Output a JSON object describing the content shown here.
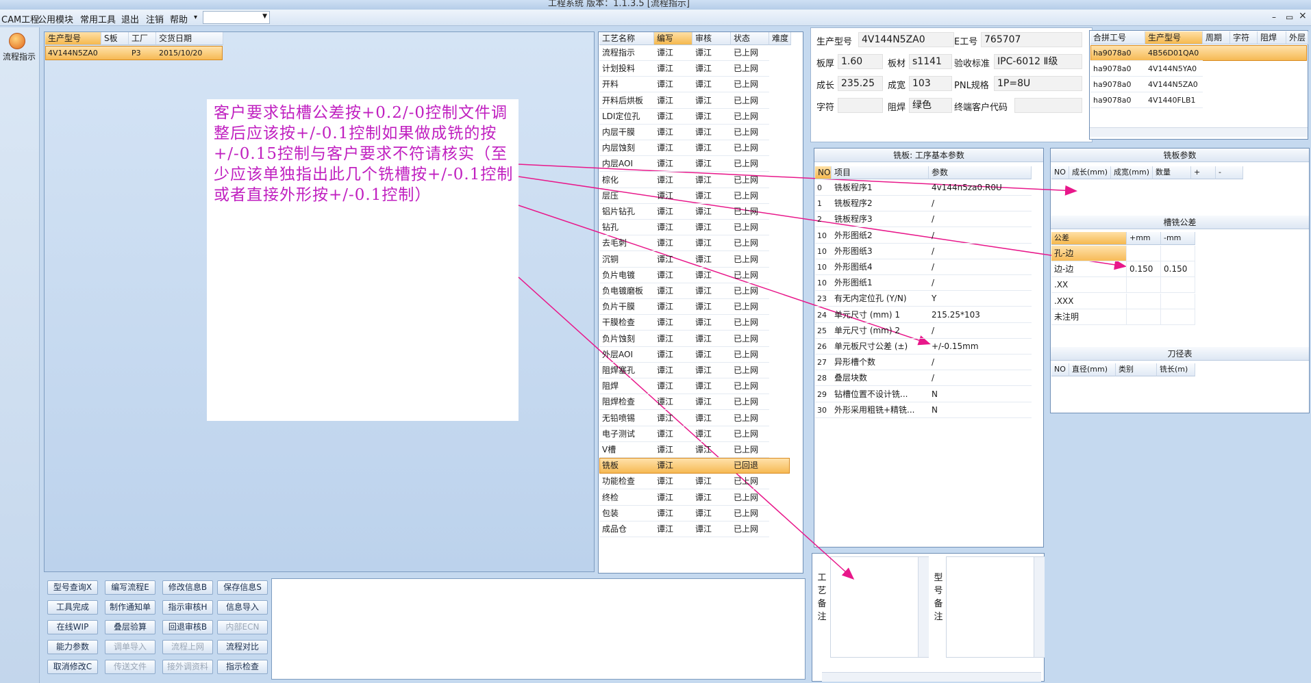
{
  "window": {
    "title": "工程系统   版本：1.1.3.5  [流程指示]"
  },
  "menu": {
    "items": [
      "CAM工程",
      "公用模块",
      "常用工具",
      "退出",
      "注销",
      "帮助"
    ],
    "help_arrow": "▾",
    "combo_value": ""
  },
  "window_controls": {
    "min": "–",
    "restore": "▭",
    "close": "×"
  },
  "nav": {
    "label": "流程指示"
  },
  "order_table": {
    "headers": [
      "生产型号",
      "S板",
      "工厂",
      "交货日期"
    ],
    "rows": [
      [
        "4V144N5ZA0",
        "",
        "P3",
        "2015/10/20"
      ]
    ]
  },
  "note": {
    "text": "客户要求钻槽公差按+0.2/-0控制文件调整后应该按+/-0.1控制如果做成铣的按+/-0.15控制与客户要求不符请核实（至少应该单独指出此几个铣槽按+/-0.1控制或者直接外形按+/-0.1控制）"
  },
  "process_table": {
    "headers": [
      "工艺名称",
      "编写",
      "审核",
      "状态",
      "难度"
    ],
    "rows": [
      [
        "流程指示",
        "谭江",
        "谭江",
        "已上网",
        ""
      ],
      [
        "计划投料",
        "谭江",
        "谭江",
        "已上网",
        ""
      ],
      [
        "开料",
        "谭江",
        "谭江",
        "已上网",
        ""
      ],
      [
        "开料后烘板",
        "谭江",
        "谭江",
        "已上网",
        ""
      ],
      [
        "LDI定位孔",
        "谭江",
        "谭江",
        "已上网",
        ""
      ],
      [
        "内层干膜",
        "谭江",
        "谭江",
        "已上网",
        ""
      ],
      [
        "内层蚀刻",
        "谭江",
        "谭江",
        "已上网",
        ""
      ],
      [
        "内层AOI",
        "谭江",
        "谭江",
        "已上网",
        ""
      ],
      [
        "棕化",
        "谭江",
        "谭江",
        "已上网",
        ""
      ],
      [
        "层压",
        "谭江",
        "谭江",
        "已上网",
        ""
      ],
      [
        "铝片钻孔",
        "谭江",
        "谭江",
        "已上网",
        ""
      ],
      [
        "钻孔",
        "谭江",
        "谭江",
        "已上网",
        ""
      ],
      [
        "去毛刺",
        "谭江",
        "谭江",
        "已上网",
        ""
      ],
      [
        "沉铜",
        "谭江",
        "谭江",
        "已上网",
        ""
      ],
      [
        "负片电镀",
        "谭江",
        "谭江",
        "已上网",
        ""
      ],
      [
        "负电镀磨板",
        "谭江",
        "谭江",
        "已上网",
        ""
      ],
      [
        "负片干膜",
        "谭江",
        "谭江",
        "已上网",
        ""
      ],
      [
        "干膜检查",
        "谭江",
        "谭江",
        "已上网",
        ""
      ],
      [
        "负片蚀刻",
        "谭江",
        "谭江",
        "已上网",
        ""
      ],
      [
        "外层AOI",
        "谭江",
        "谭江",
        "已上网",
        ""
      ],
      [
        "阻焊塞孔",
        "谭江",
        "谭江",
        "已上网",
        ""
      ],
      [
        "阻焊",
        "谭江",
        "谭江",
        "已上网",
        ""
      ],
      [
        "阻焊检查",
        "谭江",
        "谭江",
        "已上网",
        ""
      ],
      [
        "无铅喷锡",
        "谭江",
        "谭江",
        "已上网",
        ""
      ],
      [
        "电子测试",
        "谭江",
        "谭江",
        "已上网",
        ""
      ],
      [
        "V槽",
        "谭江",
        "谭江",
        "已上网",
        ""
      ],
      [
        "铣板",
        "谭江",
        "",
        "已回退",
        ""
      ],
      [
        "功能检查",
        "谭江",
        "谭江",
        "已上网",
        ""
      ],
      [
        "终检",
        "谭江",
        "谭江",
        "已上网",
        ""
      ],
      [
        "包装",
        "谭江",
        "谭江",
        "已上网",
        ""
      ],
      [
        "成品仓",
        "谭江",
        "谭江",
        "已上网",
        ""
      ]
    ]
  },
  "buttons": [
    [
      "型号查询X",
      "编写流程E",
      "修改信息B",
      "保存信息S"
    ],
    [
      "工具完成",
      "制作通知单",
      "指示审核H",
      "信息导入"
    ],
    [
      "在线WIP",
      "叠层验算",
      "回退审核B",
      "内部ECN"
    ],
    [
      "能力参数",
      "调单导入",
      "流程上网",
      "流程对比"
    ],
    [
      "取消修改C",
      "传送文件",
      "接外调资料",
      "指示检查"
    ]
  ],
  "info": {
    "model_label": "生产型号",
    "model": "4V144N5ZA0",
    "e_label": "E工号",
    "e_no": "765707",
    "thick_label": "板厚",
    "thick": "1.60",
    "mat_label": "板材",
    "mat": "s1141",
    "std_label": "验收标准",
    "std": "IPC-6012 Ⅱ级",
    "len_label": "成长",
    "len": "235.25",
    "wid_label": "成宽",
    "wid": "103",
    "pnl_label": "PNL规格",
    "pnl": "1P=8U",
    "char_label": "字符",
    "char": "",
    "mask_label": "阻焊",
    "mask": "绿色",
    "cust_label": "终端客户代码",
    "cust": ""
  },
  "merge_table": {
    "headers": [
      "合拼工号",
      "生产型号",
      "周期",
      "字符",
      "阻焊",
      "外层"
    ],
    "rows": [
      [
        "ha9078a0",
        "4B56D01QA0"
      ],
      [
        "ha9078a0",
        "4V144N5YA0"
      ],
      [
        "ha9078a0",
        "4V144N5ZA0"
      ],
      [
        "ha9078a0",
        "4V1440FLB1"
      ]
    ]
  },
  "mill_params": {
    "title": "铣板: 工序基本参数",
    "headers": [
      "NO",
      "项目",
      "参数"
    ],
    "rows": [
      [
        "0",
        "铣板程序1",
        "4v144n5za0.R0U"
      ],
      [
        "1",
        "铣板程序2",
        "/"
      ],
      [
        "2",
        "铣板程序3",
        "/"
      ],
      [
        "10",
        "外形图纸2",
        "/"
      ],
      [
        "10",
        "外形图纸3",
        "/"
      ],
      [
        "10",
        "外形图纸4",
        "/"
      ],
      [
        "10",
        "外形图纸1",
        "/"
      ],
      [
        "23",
        "有无内定位孔 (Y/N)",
        "Y"
      ],
      [
        "24",
        "单元尺寸 (mm) 1",
        "215.25*103"
      ],
      [
        "25",
        "单元尺寸 (mm) 2",
        "/"
      ],
      [
        "26",
        "单元板尺寸公差 (±)",
        "+/-0.15mm"
      ],
      [
        "27",
        "异形槽个数",
        "/"
      ],
      [
        "28",
        "叠层块数",
        "/"
      ],
      [
        "29",
        "钻槽位置不设计铣...",
        "N"
      ],
      [
        "30",
        "外形采用粗铣+精铣...",
        "N"
      ]
    ]
  },
  "mill_board": {
    "title": "铣板参数",
    "headers": [
      "NO",
      "成长(mm)",
      "成宽(mm)",
      "数量",
      "+",
      "-"
    ]
  },
  "slot_tol": {
    "title": "槽铣公差",
    "headers": [
      "公差",
      "+mm",
      "-mm"
    ],
    "rows": [
      [
        "孔-边",
        "",
        ""
      ],
      [
        "边-边",
        "0.150",
        "0.150"
      ],
      [
        ".XX",
        "",
        ""
      ],
      [
        ".XXX",
        "",
        ""
      ],
      [
        "未注明",
        "",
        ""
      ]
    ]
  },
  "tool_table": {
    "title": "刀径表",
    "headers": [
      "NO",
      "直径(mm)",
      "类别",
      "铣长(m)"
    ]
  },
  "remarks": {
    "proc_label": "工艺备注",
    "model_label": "型号备注"
  }
}
